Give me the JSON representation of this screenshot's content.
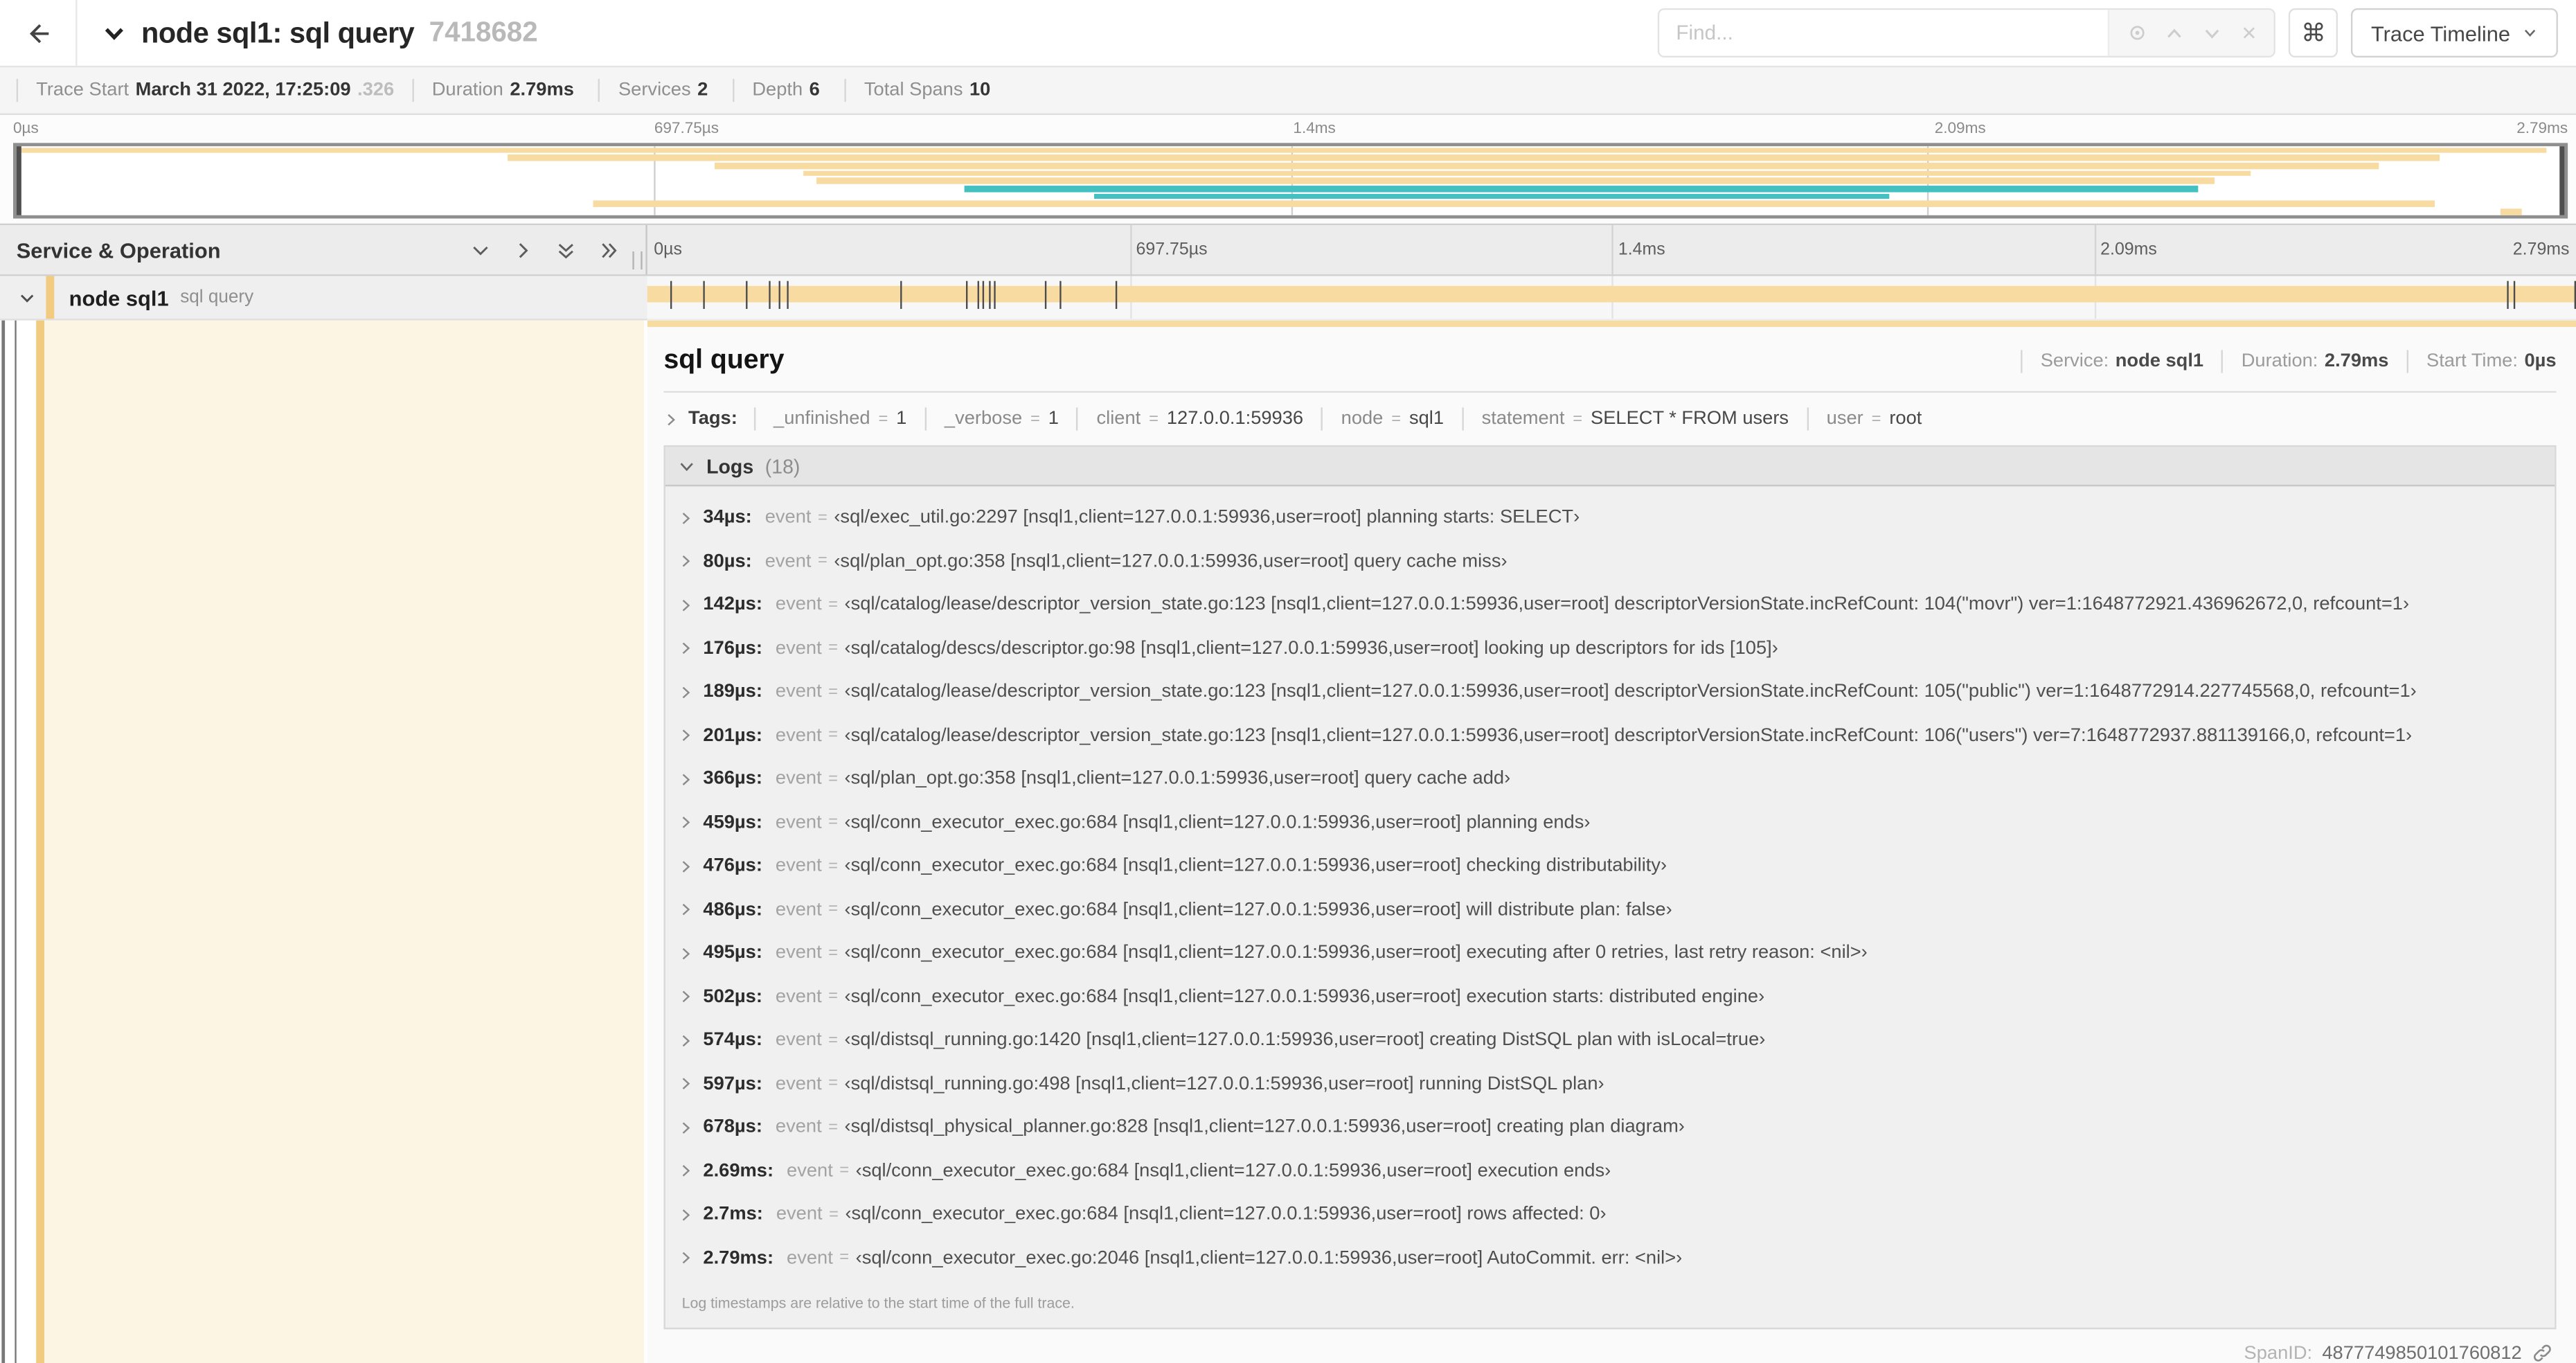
{
  "header": {
    "title": "node sql1: sql query",
    "trace_id": "7418682",
    "find_placeholder": "Find...",
    "keyboard_shortcut": "⌘",
    "view_select_label": "Trace Timeline"
  },
  "trace_meta": {
    "items": [
      {
        "label": "Trace Start",
        "value": "March 31 2022, 17:25:09",
        "suffix": ".326"
      },
      {
        "label": "Duration",
        "value": "2.79ms",
        "suffix": ""
      },
      {
        "label": "Services",
        "value": "2",
        "suffix": ""
      },
      {
        "label": "Depth",
        "value": "6",
        "suffix": ""
      },
      {
        "label": "Total Spans",
        "value": "10",
        "suffix": ""
      }
    ]
  },
  "minimap": {
    "ticks": [
      "0µs",
      "697.75µs",
      "1.4ms",
      "2.09ms",
      "2.79ms"
    ],
    "colors": {
      "tan": "#f8dba0",
      "teal": "#44c0c0"
    },
    "spans": [
      {
        "start": 0,
        "end": 99.3,
        "color": "tan"
      },
      {
        "start": 19.3,
        "end": 95.1,
        "color": "tan"
      },
      {
        "start": 27.4,
        "end": 92.7,
        "color": "tan"
      },
      {
        "start": 30.9,
        "end": 87.7,
        "color": "tan"
      },
      {
        "start": 31.4,
        "end": 86.3,
        "color": "tan"
      },
      {
        "start": 37.2,
        "end": 85.6,
        "color": "teal"
      },
      {
        "start": 42.3,
        "end": 73.5,
        "color": "teal"
      },
      {
        "start": 22.6,
        "end": 94.9,
        "color": "tan"
      },
      {
        "start": 97.5,
        "end": 98.3,
        "color": "tan"
      }
    ]
  },
  "timeline": {
    "header_title": "Service & Operation",
    "ruler_ticks": [
      "0µs",
      "697.75µs",
      "1.4ms",
      "2.09ms",
      "2.79ms"
    ],
    "row": {
      "service": "node sql1",
      "operation": "sql query",
      "log_tick_pcts": [
        1.2,
        2.9,
        5.1,
        6.3,
        6.8,
        7.2,
        13.1,
        16.5,
        17.1,
        17.4,
        17.7,
        18.0,
        20.6,
        21.4,
        24.3,
        96.4,
        96.8,
        99.9
      ]
    }
  },
  "detail": {
    "title": "sql query",
    "meta": [
      {
        "label": "Service:",
        "value": "node sql1"
      },
      {
        "label": "Duration:",
        "value": "2.79ms"
      },
      {
        "label": "Start Time:",
        "value": "0µs"
      }
    ],
    "tags_label": "Tags:",
    "tags": [
      {
        "key": "_unfinished",
        "value": "1"
      },
      {
        "key": "_verbose",
        "value": "1"
      },
      {
        "key": "client",
        "value": "127.0.0.1:59936"
      },
      {
        "key": "node",
        "value": "sql1"
      },
      {
        "key": "statement",
        "value": "SELECT * FROM users"
      },
      {
        "key": "user",
        "value": "root"
      }
    ],
    "logs": {
      "label": "Logs",
      "count": "(18)",
      "entries": [
        {
          "time": "34µs:",
          "key": "event",
          "value": "‹sql/exec_util.go:2297 [nsql1,client=127.0.0.1:59936,user=root] planning starts: SELECT›"
        },
        {
          "time": "80µs:",
          "key": "event",
          "value": "‹sql/plan_opt.go:358 [nsql1,client=127.0.0.1:59936,user=root] query cache miss›"
        },
        {
          "time": "142µs:",
          "key": "event",
          "value": "‹sql/catalog/lease/descriptor_version_state.go:123 [nsql1,client=127.0.0.1:59936,user=root] descriptorVersionState.incRefCount: 104(\"movr\") ver=1:1648772921.436962672,0, refcount=1›"
        },
        {
          "time": "176µs:",
          "key": "event",
          "value": "‹sql/catalog/descs/descriptor.go:98 [nsql1,client=127.0.0.1:59936,user=root] looking up descriptors for ids [105]›"
        },
        {
          "time": "189µs:",
          "key": "event",
          "value": "‹sql/catalog/lease/descriptor_version_state.go:123 [nsql1,client=127.0.0.1:59936,user=root] descriptorVersionState.incRefCount: 105(\"public\") ver=1:1648772914.227745568,0, refcount=1›"
        },
        {
          "time": "201µs:",
          "key": "event",
          "value": "‹sql/catalog/lease/descriptor_version_state.go:123 [nsql1,client=127.0.0.1:59936,user=root] descriptorVersionState.incRefCount: 106(\"users\") ver=7:1648772937.881139166,0, refcount=1›"
        },
        {
          "time": "366µs:",
          "key": "event",
          "value": "‹sql/plan_opt.go:358 [nsql1,client=127.0.0.1:59936,user=root] query cache add›"
        },
        {
          "time": "459µs:",
          "key": "event",
          "value": "‹sql/conn_executor_exec.go:684 [nsql1,client=127.0.0.1:59936,user=root] planning ends›"
        },
        {
          "time": "476µs:",
          "key": "event",
          "value": "‹sql/conn_executor_exec.go:684 [nsql1,client=127.0.0.1:59936,user=root] checking distributability›"
        },
        {
          "time": "486µs:",
          "key": "event",
          "value": "‹sql/conn_executor_exec.go:684 [nsql1,client=127.0.0.1:59936,user=root] will distribute plan: false›"
        },
        {
          "time": "495µs:",
          "key": "event",
          "value": "‹sql/conn_executor_exec.go:684 [nsql1,client=127.0.0.1:59936,user=root] executing after 0 retries, last retry reason: <nil>›"
        },
        {
          "time": "502µs:",
          "key": "event",
          "value": "‹sql/conn_executor_exec.go:684 [nsql1,client=127.0.0.1:59936,user=root] execution starts: distributed engine›"
        },
        {
          "time": "574µs:",
          "key": "event",
          "value": "‹sql/distsql_running.go:1420 [nsql1,client=127.0.0.1:59936,user=root] creating DistSQL plan with isLocal=true›"
        },
        {
          "time": "597µs:",
          "key": "event",
          "value": "‹sql/distsql_running.go:498 [nsql1,client=127.0.0.1:59936,user=root] running DistSQL plan›"
        },
        {
          "time": "678µs:",
          "key": "event",
          "value": "‹sql/distsql_physical_planner.go:828 [nsql1,client=127.0.0.1:59936,user=root] creating plan diagram›"
        },
        {
          "time": "2.69ms:",
          "key": "event",
          "value": "‹sql/conn_executor_exec.go:684 [nsql1,client=127.0.0.1:59936,user=root] execution ends›"
        },
        {
          "time": "2.7ms:",
          "key": "event",
          "value": "‹sql/conn_executor_exec.go:684 [nsql1,client=127.0.0.1:59936,user=root] rows affected: 0›"
        },
        {
          "time": "2.79ms:",
          "key": "event",
          "value": "‹sql/conn_executor_exec.go:2046 [nsql1,client=127.0.0.1:59936,user=root] AutoCommit. err: <nil>›"
        }
      ],
      "footnote": "Log timestamps are relative to the start time of the full trace."
    },
    "span_id_label": "SpanID:",
    "span_id": "4877749850101760812"
  }
}
